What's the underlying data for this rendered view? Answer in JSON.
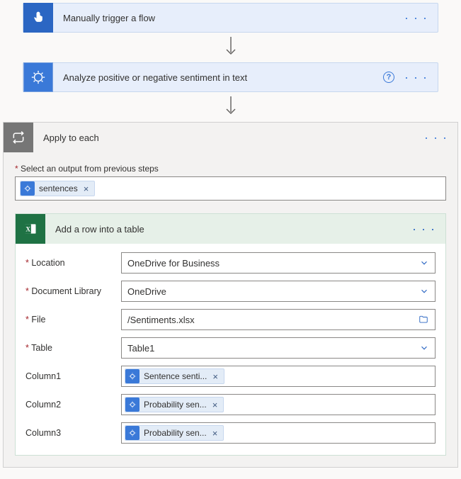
{
  "steps": {
    "trigger": {
      "title": "Manually trigger a flow"
    },
    "sentiment": {
      "title": "Analyze positive or negative sentiment in text"
    },
    "loop": {
      "title": "Apply to each",
      "output_label": "Select an output from previous steps",
      "output_token": "sentences"
    },
    "excel": {
      "title": "Add a row into a table",
      "fields": {
        "location": {
          "label": "Location",
          "value": "OneDrive for Business"
        },
        "doclib": {
          "label": "Document Library",
          "value": "OneDrive"
        },
        "file": {
          "label": "File",
          "value": "/Sentiments.xlsx"
        },
        "table": {
          "label": "Table",
          "value": "Table1"
        },
        "column1": {
          "label": "Column1",
          "token": "Sentence senti..."
        },
        "column2": {
          "label": "Column2",
          "token": "Probability sen..."
        },
        "column3": {
          "label": "Column3",
          "token": "Probability sen..."
        }
      }
    }
  }
}
